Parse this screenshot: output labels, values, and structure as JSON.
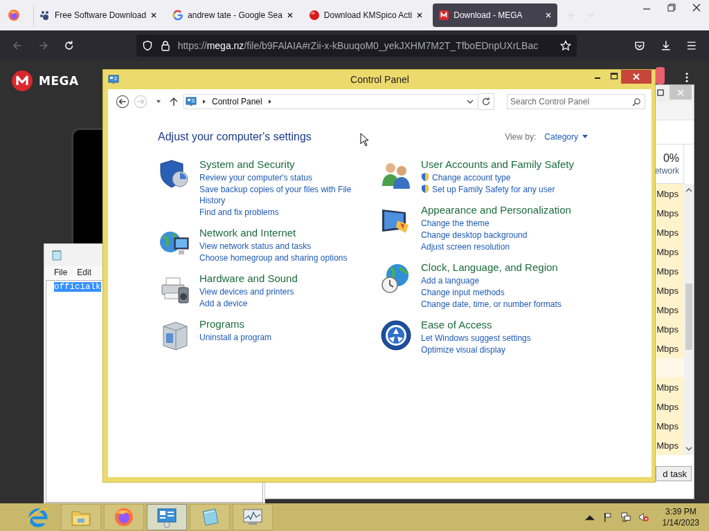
{
  "browser": {
    "tabs": [
      {
        "kind": "software",
        "title": "Free Software Download",
        "selected": false
      },
      {
        "kind": "google",
        "title": "andrew tate - Google Sea",
        "selected": false
      },
      {
        "kind": "kmspico",
        "title": "Download KMSpico Acti",
        "selected": false
      },
      {
        "kind": "mega",
        "title": "Download - MEGA",
        "selected": true
      }
    ],
    "url": {
      "scheme": "https://",
      "host": "mega.nz",
      "path": "/file/b9FAlAIA#rZii-x-kBuuqoM0_yekJXHM7M2T_TfboEDnpUXrLBac"
    }
  },
  "mega": {
    "logo": "MEGA"
  },
  "task_manager": {
    "network_total": "0%",
    "network_heading": "etwork",
    "rows": [
      {
        "kind": "reading",
        "value": "Mbps"
      },
      {
        "kind": "reading",
        "value": "Mbps"
      },
      {
        "kind": "reading",
        "value": "Mbps"
      },
      {
        "kind": "reading",
        "value": "Mbps"
      },
      {
        "kind": "reading",
        "value": "Mbps"
      },
      {
        "kind": "reading",
        "value": "Mbps"
      },
      {
        "kind": "reading",
        "value": "Mbps"
      },
      {
        "kind": "reading",
        "value": "Mbps"
      },
      {
        "kind": "reading",
        "value": "Mbps"
      },
      {
        "kind": "blank"
      },
      {
        "kind": "reading",
        "value": "Mbps"
      },
      {
        "kind": "reading",
        "value": "Mbps"
      },
      {
        "kind": "reading",
        "value": "Mbps"
      },
      {
        "kind": "reading",
        "value": "Mbps"
      }
    ],
    "button": "d task"
  },
  "notepad": {
    "menu": [
      "File",
      "Edit"
    ],
    "text": "officialk",
    "selected": true
  },
  "control_panel": {
    "title": "Control Panel",
    "address": "Control Panel",
    "search": {
      "placeholder": "Search Control Panel"
    },
    "heading": "Adjust your computer's settings",
    "view_by": {
      "label": "View by:",
      "value": "Category"
    },
    "columns": [
      [
        {
          "kind": "security",
          "title": "System and Security",
          "links": [
            {
              "text": "Review your computer's status",
              "shield": false
            },
            {
              "text": "Save backup copies of your files with File History",
              "shield": false
            },
            {
              "text": "Find and fix problems",
              "shield": false
            }
          ]
        },
        {
          "kind": "network",
          "title": "Network and Internet",
          "links": [
            {
              "text": "View network status and tasks",
              "shield": false
            },
            {
              "text": "Choose homegroup and sharing options",
              "shield": false
            }
          ]
        },
        {
          "kind": "hardware",
          "title": "Hardware and Sound",
          "links": [
            {
              "text": "View devices and printers",
              "shield": false
            },
            {
              "text": "Add a device",
              "shield": false
            }
          ]
        },
        {
          "kind": "programs",
          "title": "Programs",
          "links": [
            {
              "text": "Uninstall a program",
              "shield": false
            }
          ]
        }
      ],
      [
        {
          "kind": "users",
          "title": "User Accounts and Family Safety",
          "links": [
            {
              "text": "Change account type",
              "shield": true
            },
            {
              "text": "Set up Family Safety for any user",
              "shield": true
            }
          ]
        },
        {
          "kind": "appearance",
          "title": "Appearance and Personalization",
          "links": [
            {
              "text": "Change the theme",
              "shield": false
            },
            {
              "text": "Change desktop background",
              "shield": false
            },
            {
              "text": "Adjust screen resolution",
              "shield": false
            }
          ]
        },
        {
          "kind": "clock",
          "title": "Clock, Language, and Region",
          "links": [
            {
              "text": "Add a language",
              "shield": false
            },
            {
              "text": "Change input methods",
              "shield": false
            },
            {
              "text": "Change date, time, or number formats",
              "shield": false
            }
          ]
        },
        {
          "kind": "access",
          "title": "Ease of Access",
          "links": [
            {
              "text": "Let Windows suggest settings",
              "shield": false
            },
            {
              "text": "Optimize visual display",
              "shield": false
            }
          ]
        }
      ]
    ]
  },
  "taskbar": {
    "apps": [
      {
        "kind": "ie",
        "running": false,
        "active": false
      },
      {
        "kind": "explorer",
        "running": true,
        "active": false
      },
      {
        "kind": "firefox",
        "running": true,
        "active": false
      },
      {
        "kind": "control-panel",
        "running": true,
        "active": true
      },
      {
        "kind": "notepad",
        "running": true,
        "active": false
      },
      {
        "kind": "monitor",
        "running": true,
        "active": false
      }
    ],
    "tray": {
      "time": "3:39 PM",
      "date": "1/14/2023",
      "muted": true
    }
  }
}
